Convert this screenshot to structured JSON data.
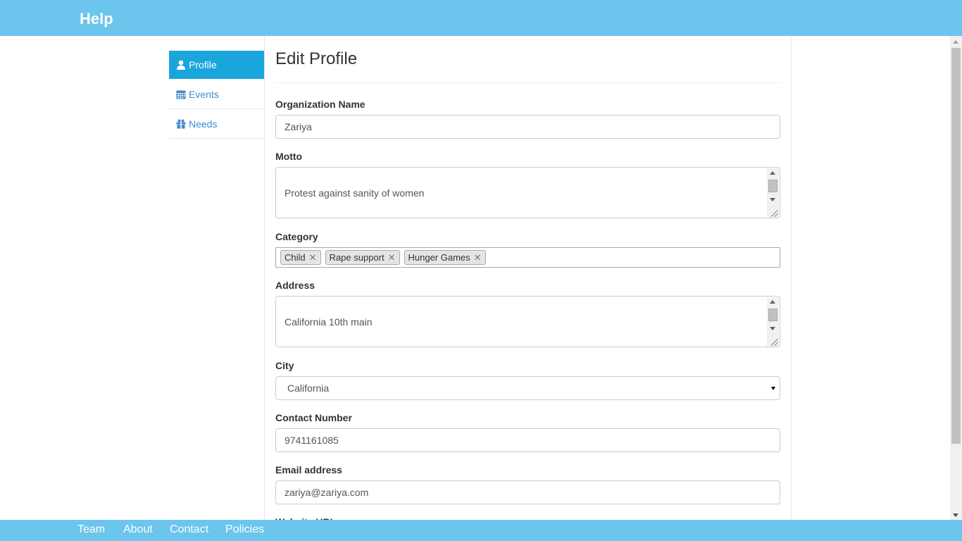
{
  "navbar": {
    "brand": "Help"
  },
  "sidebar": {
    "items": [
      {
        "label": "Profile",
        "icon": "user-icon"
      },
      {
        "label": "Events",
        "icon": "calendar-icon"
      },
      {
        "label": "Needs",
        "icon": "gift-icon"
      }
    ]
  },
  "form": {
    "title": "Edit Profile",
    "organization": {
      "label": "Organization Name",
      "value": "Zariya"
    },
    "motto": {
      "label": "Motto",
      "value": "Protest against sanity of women"
    },
    "category": {
      "label": "Category",
      "tags": [
        "Child",
        "Rape support",
        "Hunger Games"
      ],
      "remove_glyph": "✕"
    },
    "address": {
      "label": "Address",
      "value": "California 10th main"
    },
    "city": {
      "label": "City",
      "value": "California"
    },
    "contact": {
      "label": "Contact Number",
      "value": "9741161085"
    },
    "email": {
      "label": "Email address",
      "value": "zariya@zariya.com"
    },
    "website": {
      "label": "Website URL"
    }
  },
  "footer": {
    "links": [
      "Team",
      "About",
      "Contact",
      "Policies"
    ]
  },
  "colors": {
    "navbar": "#6bc5ec",
    "active_nav": "#1ba5dd",
    "link": "#428bca"
  }
}
